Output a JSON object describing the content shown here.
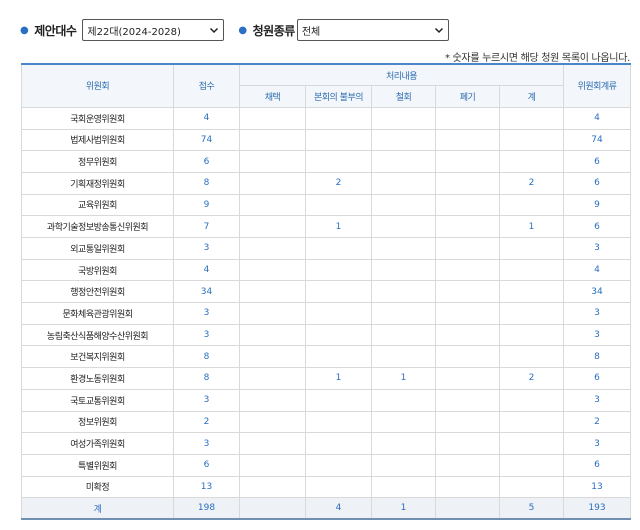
{
  "filters": {
    "session_label": "제안대수",
    "session_value": "제22대(2024-2028)",
    "type_label": "청원종류",
    "type_value": "전체"
  },
  "notice": "* 숫자를 누르시면 해당 청원 목록이 나옵니다.",
  "table": {
    "headers": {
      "committee": "위원회",
      "received": "접수",
      "processing": "처리내용",
      "adopted": "채택",
      "plenary_not_referred": "본회의 불부의",
      "withdrawn": "철회",
      "discarded": "폐기",
      "total": "계",
      "pending": "위원회계류"
    },
    "rows": [
      {
        "name": "국회운영위원회",
        "received": "4",
        "adopted": "",
        "not_referred": "",
        "withdrawn": "",
        "discarded": "",
        "total": "",
        "pending": "4"
      },
      {
        "name": "법제사법위원회",
        "received": "74",
        "adopted": "",
        "not_referred": "",
        "withdrawn": "",
        "discarded": "",
        "total": "",
        "pending": "74"
      },
      {
        "name": "정무위원회",
        "received": "6",
        "adopted": "",
        "not_referred": "",
        "withdrawn": "",
        "discarded": "",
        "total": "",
        "pending": "6"
      },
      {
        "name": "기획재정위원회",
        "received": "8",
        "adopted": "",
        "not_referred": "2",
        "withdrawn": "",
        "discarded": "",
        "total": "2",
        "pending": "6"
      },
      {
        "name": "교육위원회",
        "received": "9",
        "adopted": "",
        "not_referred": "",
        "withdrawn": "",
        "discarded": "",
        "total": "",
        "pending": "9"
      },
      {
        "name": "과학기술정보방송통신위원회",
        "received": "7",
        "adopted": "",
        "not_referred": "1",
        "withdrawn": "",
        "discarded": "",
        "total": "1",
        "pending": "6"
      },
      {
        "name": "외교통일위원회",
        "received": "3",
        "adopted": "",
        "not_referred": "",
        "withdrawn": "",
        "discarded": "",
        "total": "",
        "pending": "3"
      },
      {
        "name": "국방위원회",
        "received": "4",
        "adopted": "",
        "not_referred": "",
        "withdrawn": "",
        "discarded": "",
        "total": "",
        "pending": "4"
      },
      {
        "name": "행정안전위원회",
        "received": "34",
        "adopted": "",
        "not_referred": "",
        "withdrawn": "",
        "discarded": "",
        "total": "",
        "pending": "34"
      },
      {
        "name": "문화체육관광위원회",
        "received": "3",
        "adopted": "",
        "not_referred": "",
        "withdrawn": "",
        "discarded": "",
        "total": "",
        "pending": "3"
      },
      {
        "name": "농림축산식품해양수산위원회",
        "received": "3",
        "adopted": "",
        "not_referred": "",
        "withdrawn": "",
        "discarded": "",
        "total": "",
        "pending": "3"
      },
      {
        "name": "보건복지위원회",
        "received": "8",
        "adopted": "",
        "not_referred": "",
        "withdrawn": "",
        "discarded": "",
        "total": "",
        "pending": "8"
      },
      {
        "name": "환경노동위원회",
        "received": "8",
        "adopted": "",
        "not_referred": "1",
        "withdrawn": "1",
        "discarded": "",
        "total": "2",
        "pending": "6"
      },
      {
        "name": "국토교통위원회",
        "received": "3",
        "adopted": "",
        "not_referred": "",
        "withdrawn": "",
        "discarded": "",
        "total": "",
        "pending": "3"
      },
      {
        "name": "정보위원회",
        "received": "2",
        "adopted": "",
        "not_referred": "",
        "withdrawn": "",
        "discarded": "",
        "total": "",
        "pending": "2"
      },
      {
        "name": "여성가족위원회",
        "received": "3",
        "adopted": "",
        "not_referred": "",
        "withdrawn": "",
        "discarded": "",
        "total": "",
        "pending": "3"
      },
      {
        "name": "특별위원회",
        "received": "6",
        "adopted": "",
        "not_referred": "",
        "withdrawn": "",
        "discarded": "",
        "total": "",
        "pending": "6"
      },
      {
        "name": "미확정",
        "received": "13",
        "adopted": "",
        "not_referred": "",
        "withdrawn": "",
        "discarded": "",
        "total": "",
        "pending": "13"
      }
    ],
    "totals": {
      "name": "계",
      "received": "198",
      "adopted": "",
      "not_referred": "4",
      "withdrawn": "1",
      "discarded": "",
      "total": "5",
      "pending": "193"
    }
  }
}
